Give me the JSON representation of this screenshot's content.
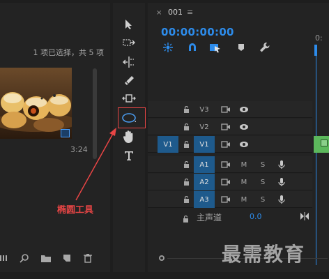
{
  "project": {
    "selection_count": "1 项已选择，共 5 项",
    "clip_duration": "3:24"
  },
  "timeline": {
    "tab_close": "×",
    "sequence_name": "001",
    "tab_menu": "≡",
    "timecode": "00:00:00:00",
    "ruler_label": "0:",
    "source_patch": "V1",
    "tracks": [
      {
        "label": "V3",
        "type": "video",
        "active": false
      },
      {
        "label": "V2",
        "type": "video",
        "active": false
      },
      {
        "label": "V1",
        "type": "video",
        "active": true
      },
      {
        "label": "A1",
        "type": "audio",
        "active": true
      },
      {
        "label": "A2",
        "type": "audio",
        "active": true
      },
      {
        "label": "A3",
        "type": "audio",
        "active": true
      }
    ],
    "audio_m": "M",
    "audio_s": "S",
    "master_label": "主声道",
    "master_value": "0.0"
  },
  "annotation": {
    "text": "椭圆工具",
    "color": "#e84545"
  },
  "watermark": "最需教育",
  "colors": {
    "accent": "#2d8ceb",
    "track_on": "#1e5a8c",
    "clip": "#5cb85c"
  }
}
